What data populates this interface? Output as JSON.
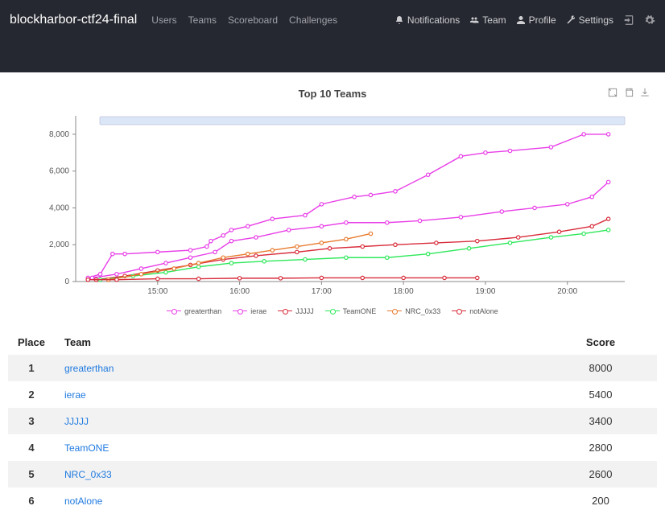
{
  "brand": "blockharbor-ctf24-final",
  "nav": {
    "left": [
      "Users",
      "Teams",
      "Scoreboard",
      "Challenges"
    ],
    "right_notifications": "Notifications",
    "right_team": "Team",
    "right_profile": "Profile",
    "right_settings": "Settings"
  },
  "chart_data": {
    "type": "line",
    "title": "Top 10 Teams",
    "ylabel": "",
    "xlabel": "",
    "ylim": [
      0,
      9000
    ],
    "y_ticks": [
      0,
      2000,
      4000,
      6000,
      8000
    ],
    "y_tick_labels": [
      "0",
      "2,000",
      "4,000",
      "6,000",
      "8,000"
    ],
    "x_ticks": [
      15,
      16,
      17,
      18,
      19,
      20
    ],
    "x_tick_labels": [
      "15:00",
      "16:00",
      "17:00",
      "18:00",
      "19:00",
      "20:00"
    ],
    "x_range": [
      14.0,
      20.7
    ],
    "series": [
      {
        "name": "greaterthan",
        "color": "#e83ee8",
        "points": [
          [
            14.15,
            200
          ],
          [
            14.3,
            400
          ],
          [
            14.45,
            1500
          ],
          [
            14.6,
            1500
          ],
          [
            15.0,
            1600
          ],
          [
            15.4,
            1700
          ],
          [
            15.6,
            1900
          ],
          [
            15.65,
            2200
          ],
          [
            15.8,
            2500
          ],
          [
            15.9,
            2800
          ],
          [
            16.1,
            3000
          ],
          [
            16.4,
            3400
          ],
          [
            16.8,
            3600
          ],
          [
            17.0,
            4200
          ],
          [
            17.4,
            4600
          ],
          [
            17.6,
            4700
          ],
          [
            17.9,
            4900
          ],
          [
            18.3,
            5800
          ],
          [
            18.7,
            6800
          ],
          [
            19.0,
            7000
          ],
          [
            19.3,
            7100
          ],
          [
            19.8,
            7300
          ],
          [
            20.2,
            8000
          ],
          [
            20.5,
            8000
          ]
        ]
      },
      {
        "name": "ierae",
        "color": "#e83ee8",
        "points": [
          [
            14.2,
            200
          ],
          [
            14.5,
            400
          ],
          [
            14.8,
            700
          ],
          [
            15.1,
            1000
          ],
          [
            15.4,
            1300
          ],
          [
            15.7,
            1600
          ],
          [
            15.9,
            2200
          ],
          [
            16.2,
            2400
          ],
          [
            16.6,
            2800
          ],
          [
            17.0,
            3000
          ],
          [
            17.3,
            3200
          ],
          [
            17.8,
            3200
          ],
          [
            18.2,
            3300
          ],
          [
            18.7,
            3500
          ],
          [
            19.2,
            3800
          ],
          [
            19.6,
            4000
          ],
          [
            20.0,
            4200
          ],
          [
            20.3,
            4600
          ],
          [
            20.5,
            5400
          ]
        ]
      },
      {
        "name": "JJJJJ",
        "color": "#d82c3a",
        "points": [
          [
            14.25,
            100
          ],
          [
            14.6,
            300
          ],
          [
            15.0,
            600
          ],
          [
            15.4,
            900
          ],
          [
            15.8,
            1200
          ],
          [
            16.2,
            1400
          ],
          [
            16.7,
            1600
          ],
          [
            17.1,
            1800
          ],
          [
            17.5,
            1900
          ],
          [
            17.9,
            2000
          ],
          [
            18.4,
            2100
          ],
          [
            18.9,
            2200
          ],
          [
            19.4,
            2400
          ],
          [
            19.9,
            2700
          ],
          [
            20.3,
            3000
          ],
          [
            20.5,
            3400
          ]
        ]
      },
      {
        "name": "TeamONE",
        "color": "#2ee85a",
        "points": [
          [
            14.3,
            100
          ],
          [
            14.7,
            300
          ],
          [
            15.1,
            500
          ],
          [
            15.5,
            800
          ],
          [
            15.9,
            1000
          ],
          [
            16.3,
            1100
          ],
          [
            16.8,
            1200
          ],
          [
            17.3,
            1300
          ],
          [
            17.8,
            1300
          ],
          [
            18.3,
            1500
          ],
          [
            18.8,
            1800
          ],
          [
            19.3,
            2100
          ],
          [
            19.8,
            2400
          ],
          [
            20.2,
            2600
          ],
          [
            20.5,
            2800
          ]
        ]
      },
      {
        "name": "NRC_0x33",
        "color": "#e87a2e",
        "points": [
          [
            14.4,
            100
          ],
          [
            14.8,
            400
          ],
          [
            15.2,
            700
          ],
          [
            15.5,
            1000
          ],
          [
            15.8,
            1300
          ],
          [
            16.1,
            1500
          ],
          [
            16.4,
            1700
          ],
          [
            16.7,
            1900
          ],
          [
            17.0,
            2100
          ],
          [
            17.3,
            2300
          ],
          [
            17.6,
            2600
          ]
        ]
      },
      {
        "name": "notAlone",
        "color": "#d82c3a",
        "points": [
          [
            14.15,
            100
          ],
          [
            14.5,
            100
          ],
          [
            15.0,
            150
          ],
          [
            15.5,
            150
          ],
          [
            16.0,
            180
          ],
          [
            16.5,
            180
          ],
          [
            17.0,
            200
          ],
          [
            17.5,
            200
          ],
          [
            18.0,
            200
          ],
          [
            18.5,
            200
          ],
          [
            18.9,
            200
          ]
        ]
      }
    ]
  },
  "table": {
    "headers": {
      "place": "Place",
      "team": "Team",
      "score": "Score"
    },
    "rows": [
      {
        "place": "1",
        "team": "greaterthan",
        "score": "8000"
      },
      {
        "place": "2",
        "team": "ierae",
        "score": "5400"
      },
      {
        "place": "3",
        "team": "JJJJJ",
        "score": "3400"
      },
      {
        "place": "4",
        "team": "TeamONE",
        "score": "2800"
      },
      {
        "place": "5",
        "team": "NRC_0x33",
        "score": "2600"
      },
      {
        "place": "6",
        "team": "notAlone",
        "score": "200"
      }
    ]
  }
}
